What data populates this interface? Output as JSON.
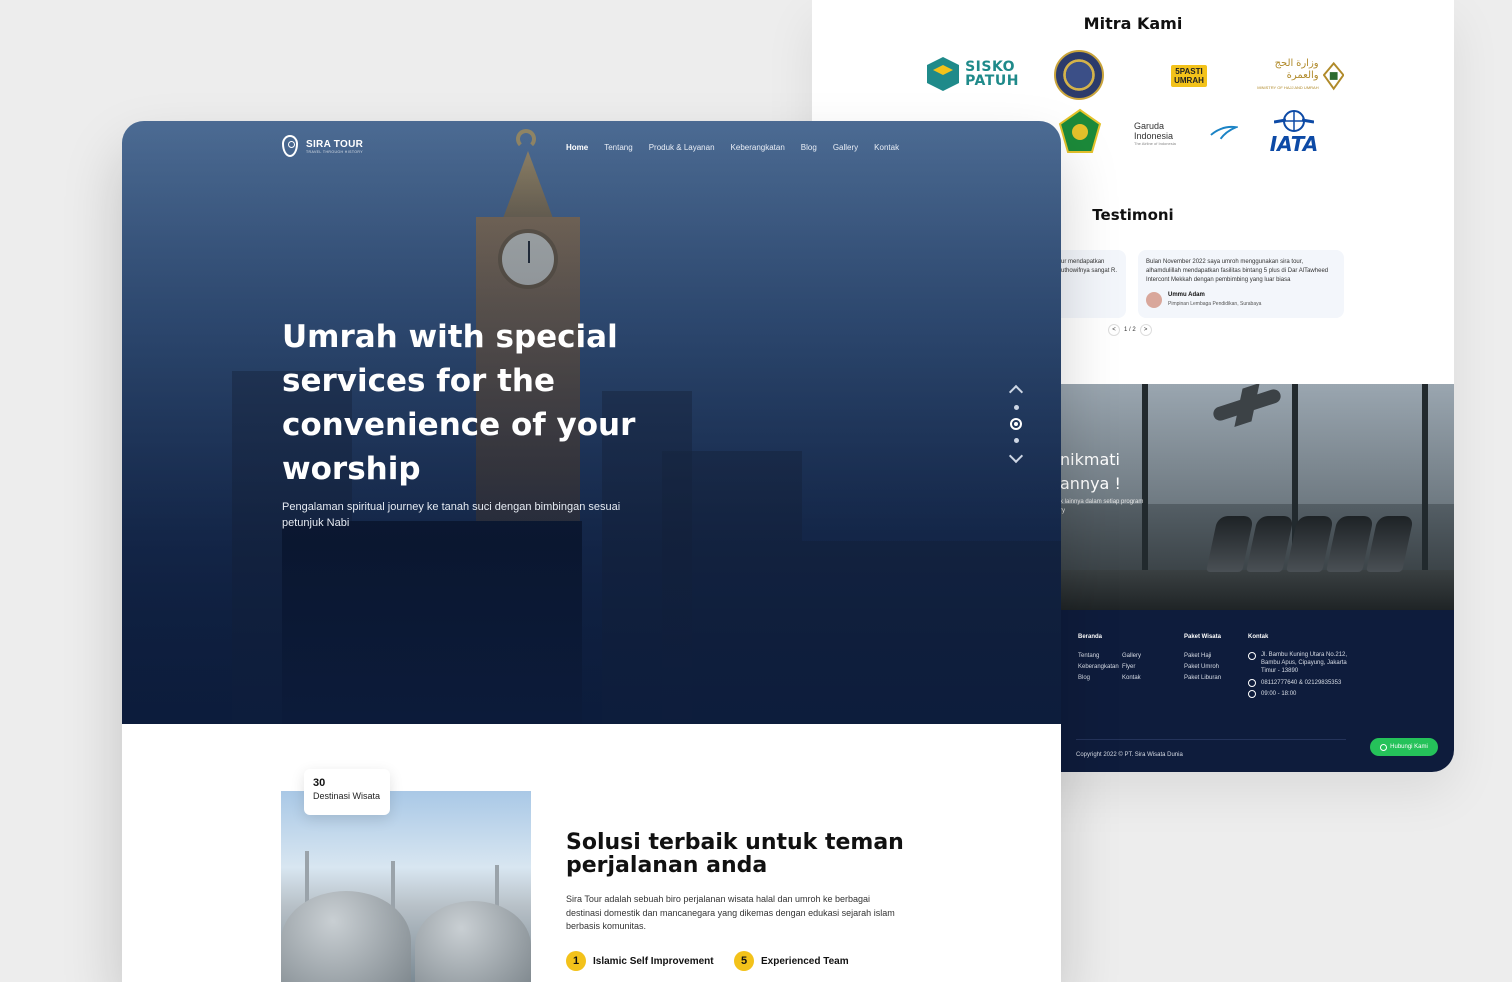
{
  "back": {
    "mitra_title": "Mitra Kami",
    "partners": {
      "sisko_line1": "SISKO",
      "sisko_line2": "PATUH",
      "pasti_line1": "5PASTI",
      "pasti_line2": "UMRAH",
      "hajj_arabic": "وزارة الحج والعمرة",
      "hajj_english": "MINISTRY OF HAJJ AND UMRAH",
      "garuda_name": "Garuda Indonesia",
      "garuda_tag": "The Airline of Indonesia",
      "iata": "IATA"
    },
    "testimoni_title": "Testimoni",
    "testimonials": [
      {
        "text": "tour mendapatkan Muthowifnya sangat R."
      },
      {
        "text": "Bulan November 2022 saya umroh menggunakan sira tour, alhamdulillah mendapatkan fasilitas bintang 5 plus di Dar AlTawheed Intercont Mekkah dengan pembimbing yang luar biasa",
        "name": "Ummu Adam",
        "role": "Pimpinan Lembaga Pendidikan, Surabaya"
      }
    ],
    "pager": {
      "prev": "<",
      "status": "1 / 2",
      "next": ">"
    },
    "cta": {
      "line1": "nikmati",
      "line2": "annya !",
      "sub_line1": "k lainnya dalam setiap program",
      "sub_line2": "ry"
    },
    "footer": {
      "col1_head": "Beranda",
      "col1_items": [
        "Tentang",
        "Keberangkatan",
        "Blog"
      ],
      "col2_items": [
        "Gallery",
        "Flyer",
        "Kontak"
      ],
      "col3_head": "Paket Wisata",
      "col3_items": [
        "Paket Haji",
        "Paket Umroh",
        "Paket Liburan"
      ],
      "col4_head": "Kontak",
      "address": "Jl. Bambu Kuning Utara No.212, Bambu Apus, Cipayung, Jakarta Timur - 13890",
      "phone": "08112777640 & 02129835353",
      "hours": "09:00 - 18:00",
      "copyright": "Copyright 2022 © PT. Sira Wisata Dunia",
      "whatsapp_button": "Hubungi Kami"
    }
  },
  "front": {
    "brand": {
      "name": "SIRA TOUR",
      "tagline": "TRAVEL THROUGH HISTORY"
    },
    "nav": [
      "Home",
      "Tentang",
      "Produk & Layanan",
      "Keberangkatan",
      "Blog",
      "Gallery",
      "Kontak"
    ],
    "hero": {
      "title": "Umrah with special services for the convenience of your worship",
      "subtitle": "Pengalaman spiritual journey ke tanah suci dengan bimbingan sesuai petunjuk Nabi"
    },
    "badge": {
      "number": "30",
      "label": "Destinasi Wisata"
    },
    "solution": {
      "title": "Solusi terbaik untuk teman perjalanan anda",
      "description": "Sira Tour adalah sebuah biro perjalanan wisata halal dan umroh ke berbagai destinasi domestik dan mancanegara yang dikemas dengan edukasi sejarah islam berbasis komunitas.",
      "features": [
        {
          "num": "1",
          "label": "Islamic Self Improvement"
        },
        {
          "num": "5",
          "label": "Experienced Team"
        }
      ]
    }
  },
  "colors": {
    "navy": "#0e1c3c",
    "accent_yellow": "#f3c21a",
    "whatsapp_green": "#25c25a"
  }
}
